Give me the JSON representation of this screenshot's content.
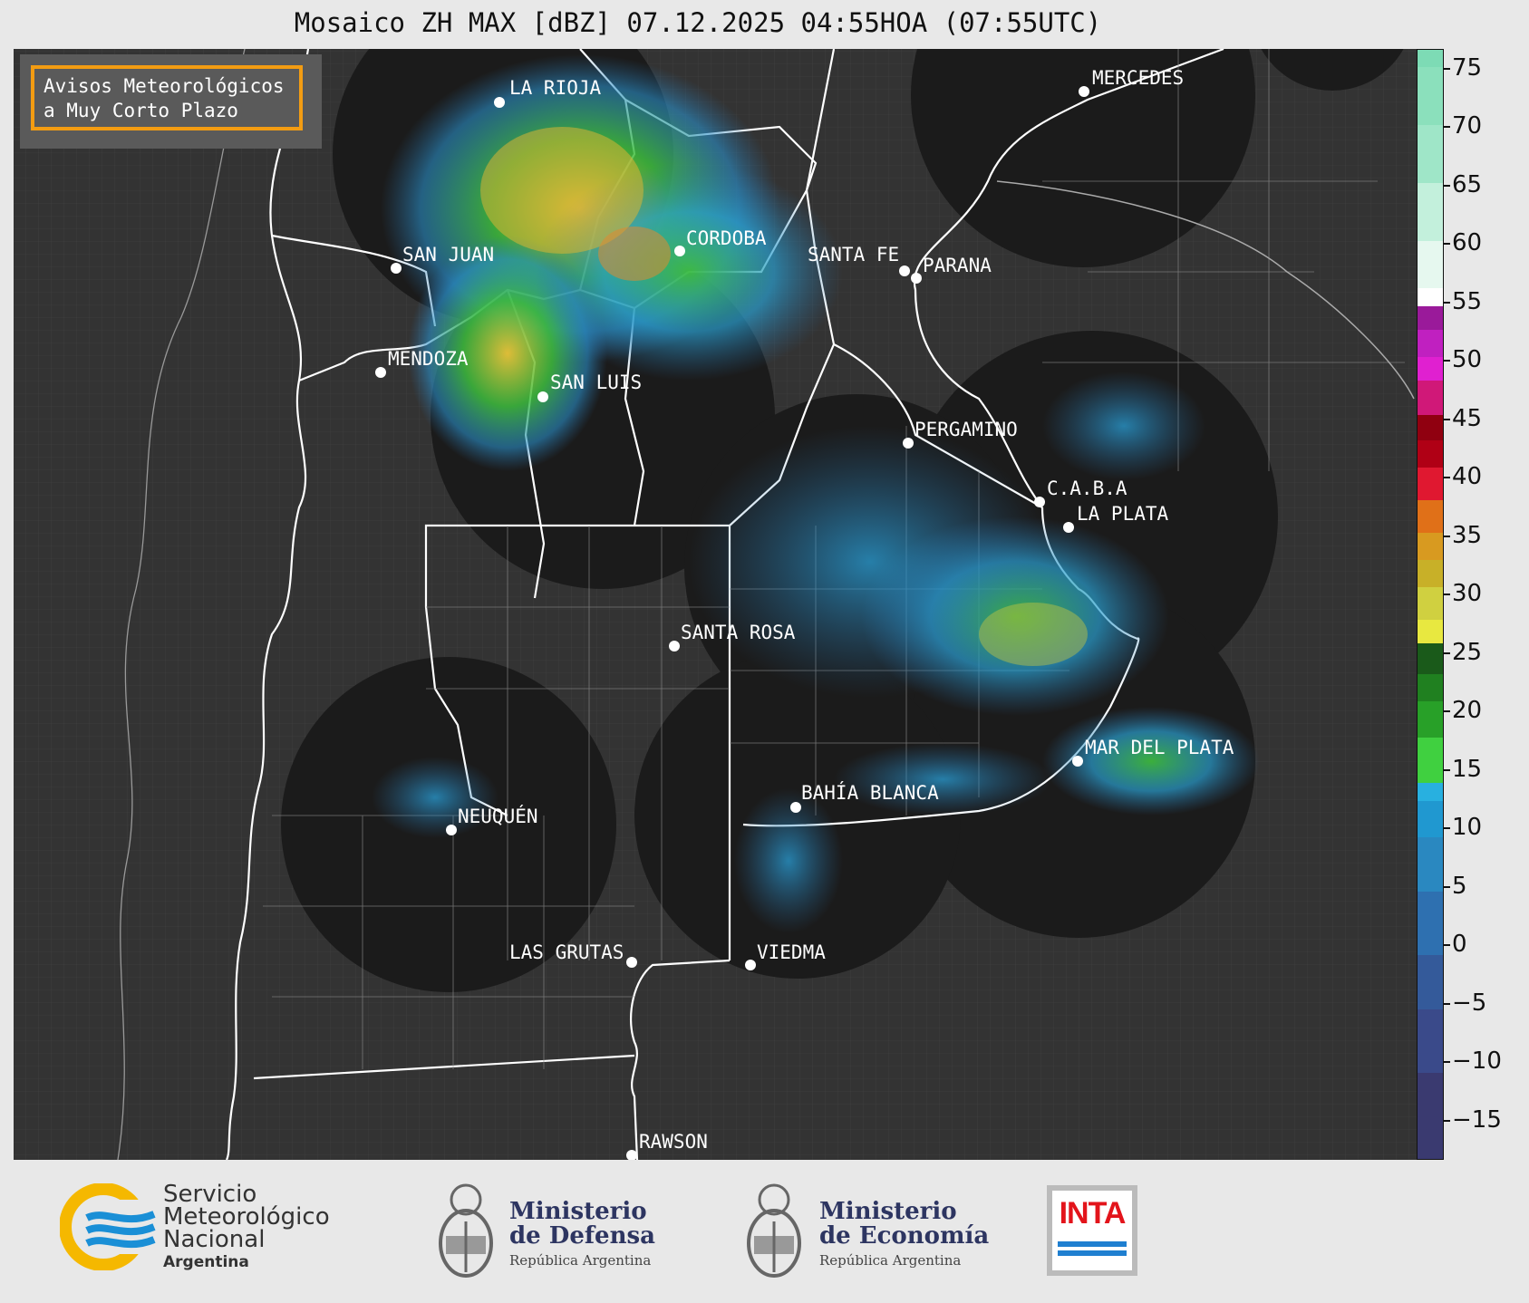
{
  "title": "Mosaico ZH MAX [dBZ] 07.12.2025 04:55HOA (07:55UTC)",
  "notice": {
    "line1": "Avisos Meteorológicos",
    "line2": "a Muy Corto Plazo"
  },
  "cities": [
    {
      "name": "LA RIOJA"
    },
    {
      "name": "CORDOBA"
    },
    {
      "name": "SAN JUAN"
    },
    {
      "name": "MENDOZA"
    },
    {
      "name": "SAN LUIS"
    },
    {
      "name": "SANTA FE"
    },
    {
      "name": "PARANA"
    },
    {
      "name": "MERCEDES"
    },
    {
      "name": "PERGAMINO"
    },
    {
      "name": "C.A.B.A"
    },
    {
      "name": "LA PLATA"
    },
    {
      "name": "SANTA ROSA"
    },
    {
      "name": "MAR DEL PLATA"
    },
    {
      "name": "BAHÍA BLANCA"
    },
    {
      "name": "NEUQUÉN"
    },
    {
      "name": "LAS GRUTAS"
    },
    {
      "name": "VIEDMA"
    },
    {
      "name": "RAWSON"
    }
  ],
  "colorbar": {
    "unit": "dBZ",
    "ticks": [
      "75",
      "70",
      "65",
      "60",
      "55",
      "50",
      "45",
      "40",
      "35",
      "30",
      "25",
      "20",
      "15",
      "10",
      "5",
      "0",
      "−5",
      "−10",
      "−15"
    ]
  },
  "logos": {
    "smn": {
      "line1": "Servicio",
      "line2": "Meteorológico",
      "line3": "Nacional",
      "country": "Argentina"
    },
    "defensa": {
      "line1": "Ministerio",
      "line2": "de Defensa",
      "sub": "República Argentina"
    },
    "economia": {
      "line1": "Ministerio",
      "line2": "de Economía",
      "sub": "República Argentina"
    },
    "inta": "INTA"
  }
}
